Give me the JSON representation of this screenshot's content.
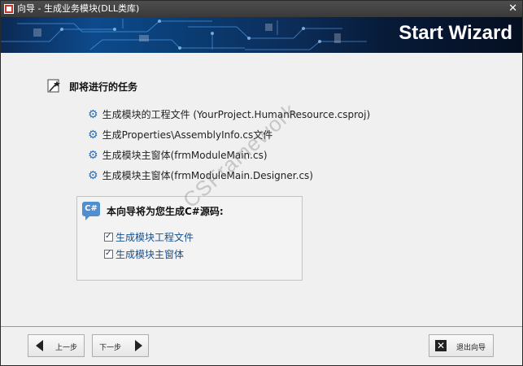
{
  "window": {
    "title": "向导 - 生成业务模块(DLL类库)",
    "close_glyph": "✕"
  },
  "banner": {
    "title": "Start Wizard"
  },
  "section": {
    "title": "即将进行的任务"
  },
  "tasks": [
    "生成模块的工程文件 (YourProject.HumanResource.csproj)",
    "生成Properties\\AssemblyInfo.cs文件",
    "生成模块主窗体(frmModuleMain.cs)",
    "生成模块主窗体(frmModuleMain.Designer.cs)"
  ],
  "info": {
    "icon_text": "C#",
    "title": "本向导将为您生成C#源码:",
    "checks": [
      {
        "label": "生成模块工程文件",
        "checked": true
      },
      {
        "label": "生成模块主窗体",
        "checked": true
      }
    ]
  },
  "watermark": "CSFramework",
  "footer": {
    "prev": "上一步",
    "next": "下一步",
    "exit": "退出向导"
  },
  "colors": {
    "accent": "#2b6fb5",
    "banner": "#0a3d74"
  },
  "icons": {
    "task": "gear-icon",
    "section": "wand-icon",
    "exit": "close-icon"
  }
}
